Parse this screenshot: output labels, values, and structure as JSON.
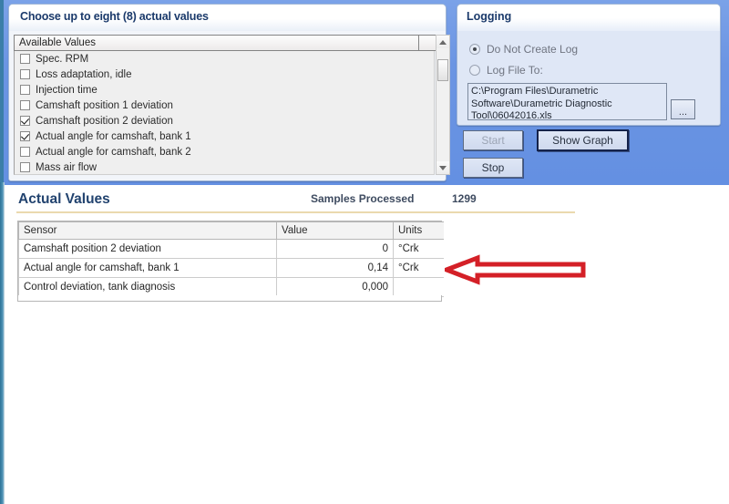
{
  "choose_panel": {
    "title": "Choose up to eight (8) actual values",
    "list_header": "Available Values",
    "items": [
      {
        "label": "Spec. RPM",
        "checked": false
      },
      {
        "label": "Loss adaptation, idle",
        "checked": false
      },
      {
        "label": "Injection time",
        "checked": false
      },
      {
        "label": "Camshaft position 1 deviation",
        "checked": false
      },
      {
        "label": "Camshaft position 2 deviation",
        "checked": true
      },
      {
        "label": "Actual angle for camshaft, bank 1",
        "checked": true
      },
      {
        "label": "Actual angle for camshaft, bank 2",
        "checked": false
      },
      {
        "label": "Mass air flow",
        "checked": false
      }
    ],
    "scroll_up_icon": "triangle-up-icon",
    "scroll_down_icon": "triangle-down-icon"
  },
  "logging_panel": {
    "title": "Logging",
    "options": [
      {
        "label": "Do Not Create Log",
        "selected": true
      },
      {
        "label": "Log File To:",
        "selected": false
      }
    ],
    "log_path": "C:\\Program Files\\Durametric Software\\Durametric Diagnostic Tool\\06042016.xls",
    "browse_label": "..."
  },
  "buttons": {
    "start": "Start",
    "stop": "Stop",
    "show_graph": "Show Graph"
  },
  "actual_values": {
    "title": "Actual Values",
    "samples_label": "Samples Processed",
    "samples_value": "1299",
    "columns": [
      "Sensor",
      "Value",
      "Units"
    ],
    "rows": [
      {
        "sensor": "Camshaft position 2 deviation",
        "value": "0",
        "units": "°Crk"
      },
      {
        "sensor": "Actual angle for camshaft, bank 1",
        "value": "0,14",
        "units": "°Crk"
      },
      {
        "sensor": "Control deviation, tank diagnosis",
        "value": "0,000",
        "units": ""
      }
    ]
  },
  "annotation": {
    "arrow_color": "#d42027",
    "arrow_direction": "left"
  },
  "theme": {
    "band_blue": "#6b95e3",
    "heading_blue": "#22436f",
    "divider_gold": "#ead9ae"
  }
}
